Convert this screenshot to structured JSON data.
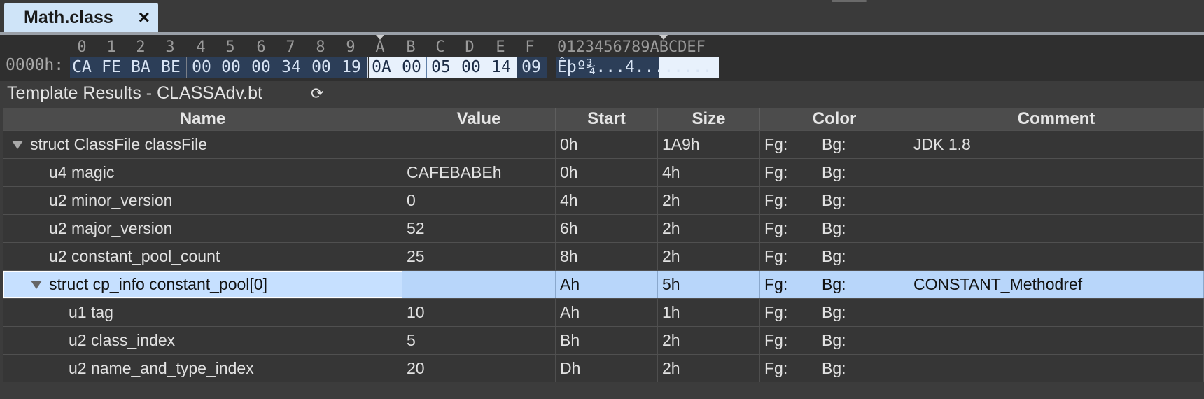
{
  "tab": {
    "title": "Math.class",
    "close": "×"
  },
  "hex": {
    "header_cols": [
      "0",
      "1",
      "2",
      "3",
      "4",
      "5",
      "6",
      "7",
      "8",
      "9",
      "A",
      "B",
      "C",
      "D",
      "E",
      "F"
    ],
    "ascii_header": "0123456789ABCDEF",
    "address": "0000h:",
    "bytes": [
      "CA",
      "FE",
      "BA",
      "BE",
      "00",
      "00",
      "00",
      "34",
      "00",
      "19",
      "0A",
      "00",
      "05",
      "00",
      "14",
      "09"
    ],
    "ascii": "Êþº¾...4........"
  },
  "results": {
    "title": "Template Results - CLASSAdv.bt",
    "refresh_icon": "refresh-icon"
  },
  "table": {
    "headers": [
      "Name",
      "Value",
      "Start",
      "Size",
      "Color",
      "Comment"
    ],
    "rows": [
      {
        "name": "struct ClassFile classFile",
        "value": "",
        "start": "0h",
        "size": "1A9h",
        "fg": "Fg:",
        "bg": "Bg:",
        "comment": "JDK 1.8"
      },
      {
        "name": "u4 magic",
        "value": "CAFEBABEh",
        "start": "0h",
        "size": "4h",
        "fg": "Fg:",
        "bg": "Bg:",
        "comment": ""
      },
      {
        "name": "u2 minor_version",
        "value": "0",
        "start": "4h",
        "size": "2h",
        "fg": "Fg:",
        "bg": "Bg:",
        "comment": ""
      },
      {
        "name": "u2 major_version",
        "value": "52",
        "start": "6h",
        "size": "2h",
        "fg": "Fg:",
        "bg": "Bg:",
        "comment": ""
      },
      {
        "name": "u2 constant_pool_count",
        "value": "25",
        "start": "8h",
        "size": "2h",
        "fg": "Fg:",
        "bg": "Bg:",
        "comment": ""
      },
      {
        "name": "struct cp_info constant_pool[0]",
        "value": "",
        "start": "Ah",
        "size": "5h",
        "fg": "Fg:",
        "bg": "Bg:",
        "comment": "CONSTANT_Methodref"
      },
      {
        "name": "u1 tag",
        "value": "10",
        "start": "Ah",
        "size": "1h",
        "fg": "Fg:",
        "bg": "Bg:",
        "comment": ""
      },
      {
        "name": "u2 class_index",
        "value": "5",
        "start": "Bh",
        "size": "2h",
        "fg": "Fg:",
        "bg": "Bg:",
        "comment": ""
      },
      {
        "name": "u2 name_and_type_index",
        "value": "20",
        "start": "Dh",
        "size": "2h",
        "fg": "Fg:",
        "bg": "Bg:",
        "comment": ""
      }
    ]
  },
  "colors": {
    "selection": "#b8d6fa",
    "tab_active": "#cfe4f8",
    "hex_highlight": "#2c3e58"
  }
}
